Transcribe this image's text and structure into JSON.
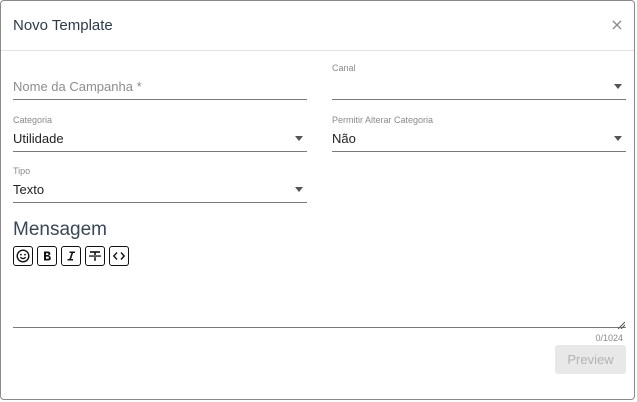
{
  "dialog": {
    "title": "Novo Template",
    "close_glyph": "×"
  },
  "form": {
    "campaign_name": {
      "placeholder": "Nome da Campanha *",
      "value": ""
    },
    "channel": {
      "label": "Canal",
      "value": ""
    },
    "category": {
      "label": "Categoria",
      "value": "Utilidade"
    },
    "allow_change_category": {
      "label": "Permitir Alterar Categoria",
      "value": "Não"
    },
    "type": {
      "label": "Tipo",
      "value": "Texto"
    }
  },
  "message": {
    "title": "Mensagem",
    "toolbar": [
      "emoji-icon",
      "bold-icon",
      "italic-icon",
      "strikethrough-icon",
      "code-icon"
    ],
    "value": "",
    "counter": "0/1024"
  },
  "actions": {
    "preview_label": "Preview"
  }
}
